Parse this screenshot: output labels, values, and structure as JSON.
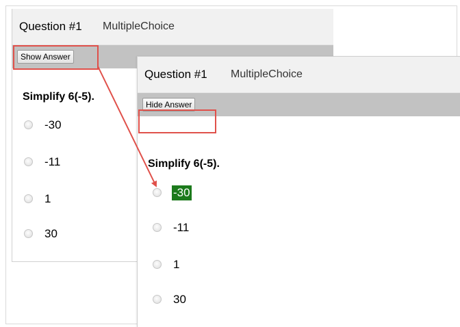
{
  "back_panel": {
    "title": "Question #1",
    "type": "MultipleChoice",
    "button_label": "Show Answer",
    "question": "Simplify 6(-5).",
    "choices": [
      "-30",
      "-11",
      "1",
      "30"
    ]
  },
  "front_panel": {
    "title": "Question #1",
    "type": "MultipleChoice",
    "button_label": "Hide Answer",
    "question": "Simplify 6(-5).",
    "choices": [
      "-30",
      "-11",
      "1",
      "30"
    ],
    "correct_choice": "-30"
  },
  "colors": {
    "annotation": "#e0504a",
    "correct_highlight": "#1c7a1c",
    "toolbar": "#c2c2c2",
    "header": "#f1f1f1"
  },
  "icons": [
    "radio-button-icon",
    "arrow-icon"
  ]
}
